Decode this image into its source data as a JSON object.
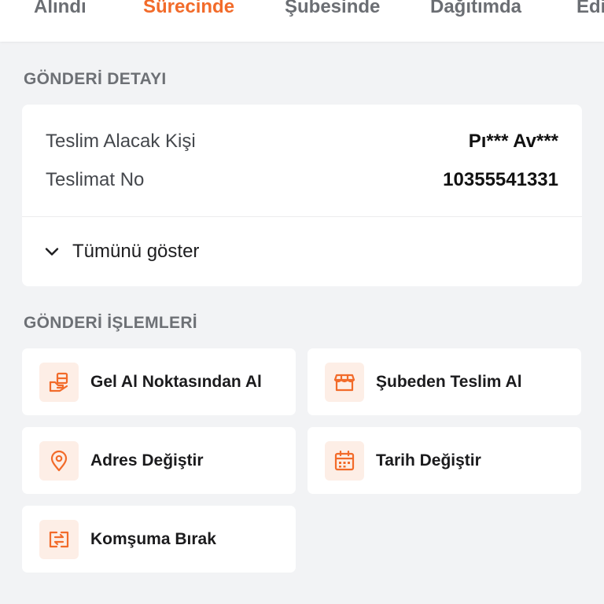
{
  "status_tabs": [
    {
      "label": "Alındı",
      "active": false
    },
    {
      "label": "Sürecinde",
      "active": true
    },
    {
      "label": "Şubesinde",
      "active": false
    },
    {
      "label": "Dağıtımda",
      "active": false
    },
    {
      "label": "Edi",
      "active": false
    }
  ],
  "detail": {
    "section_title": "GÖNDERİ DETAYI",
    "rows": [
      {
        "label": "Teslim Alacak Kişi",
        "value": "Pı*** Av***"
      },
      {
        "label": "Teslimat No",
        "value": "10355541331"
      }
    ],
    "show_all_label": "Tümünü göster"
  },
  "actions": {
    "section_title": "GÖNDERİ İŞLEMLERİ",
    "items": [
      {
        "label": "Gel Al Noktasından Al",
        "icon": "pickup-point-icon"
      },
      {
        "label": "Şubeden Teslim Al",
        "icon": "store-icon"
      },
      {
        "label": "Adres Değiştir",
        "icon": "location-pin-icon"
      },
      {
        "label": "Tarih Değiştir",
        "icon": "calendar-icon"
      },
      {
        "label": "Komşuma Bırak",
        "icon": "neighbor-transfer-icon"
      }
    ]
  },
  "colors": {
    "accent": "#f26b2a",
    "icon_bg": "#fdeee6",
    "page_bg": "#f2f3f5"
  }
}
